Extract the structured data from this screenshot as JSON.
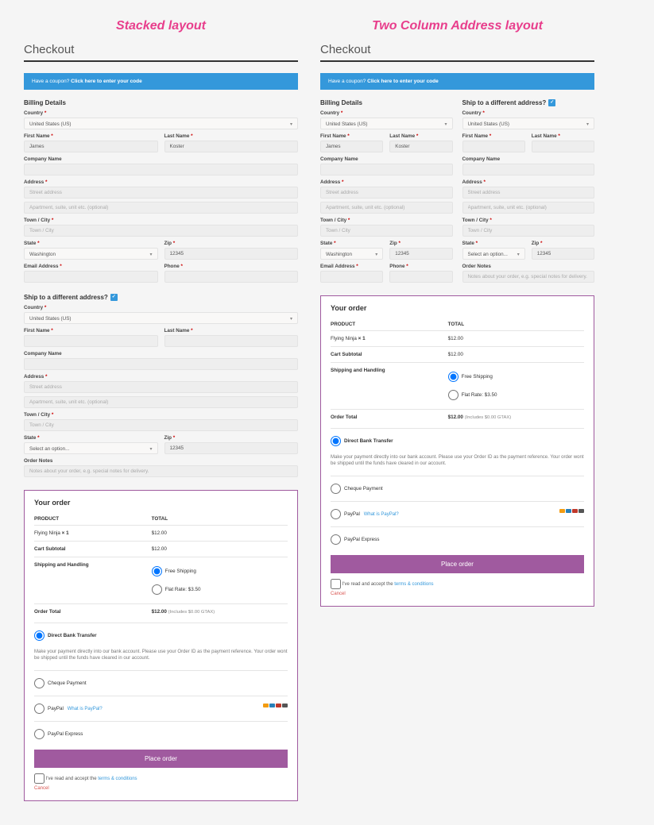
{
  "layout_left_title": "Stacked layout",
  "layout_right_title": "Two Column Address layout",
  "checkout_title": "Checkout",
  "coupon_prompt": "Have a coupon?",
  "coupon_link": "Click here to enter your code",
  "billing_heading": "Billing Details",
  "ship_heading": "Ship to a different address?",
  "labels": {
    "country": "Country",
    "first_name": "First Name",
    "last_name": "Last Name",
    "company": "Company Name",
    "address": "Address",
    "town": "Town / City",
    "state": "State",
    "zip": "Zip",
    "email": "Email Address",
    "phone": "Phone",
    "notes": "Order Notes"
  },
  "placeholders": {
    "street": "Street address",
    "apt": "Apartment, suite, unit etc. (optional)",
    "town": "Town / City",
    "notes": "Notes about your order, e.g. special notes for delivery."
  },
  "values": {
    "country": "United States (US)",
    "first_name": "James",
    "last_name": "Koster",
    "state_washington": "Washington",
    "state_select": "Select an option...",
    "zip": "12345"
  },
  "order": {
    "title": "Your order",
    "col_product": "PRODUCT",
    "col_total": "TOTAL",
    "item_name": "Flying Ninja",
    "item_qty": "× 1",
    "item_total": "$12.00",
    "subtotal_label": "Cart Subtotal",
    "subtotal": "$12.00",
    "ship_label": "Shipping and Handling",
    "ship_free": "Free Shipping",
    "ship_flat": "Flat Rate: $3.50",
    "total_label": "Order Total",
    "total": "$12.00",
    "total_tax_note": "(Includes $0.00 GTAX)",
    "pay_bank": "Direct Bank Transfer",
    "pay_bank_desc": "Make your payment directly into our bank account. Please use your Order ID as the payment reference. Your order wont be shipped until the funds have cleared in our account.",
    "pay_cheque": "Cheque Payment",
    "pay_paypal": "PayPal",
    "pay_paypal_q": "What is PayPal?",
    "pay_paypal_express": "PayPal Express",
    "place_button": "Place order",
    "terms_pre": "I've read and accept the",
    "terms_link": "terms & conditions",
    "cancel": "Cancel"
  }
}
